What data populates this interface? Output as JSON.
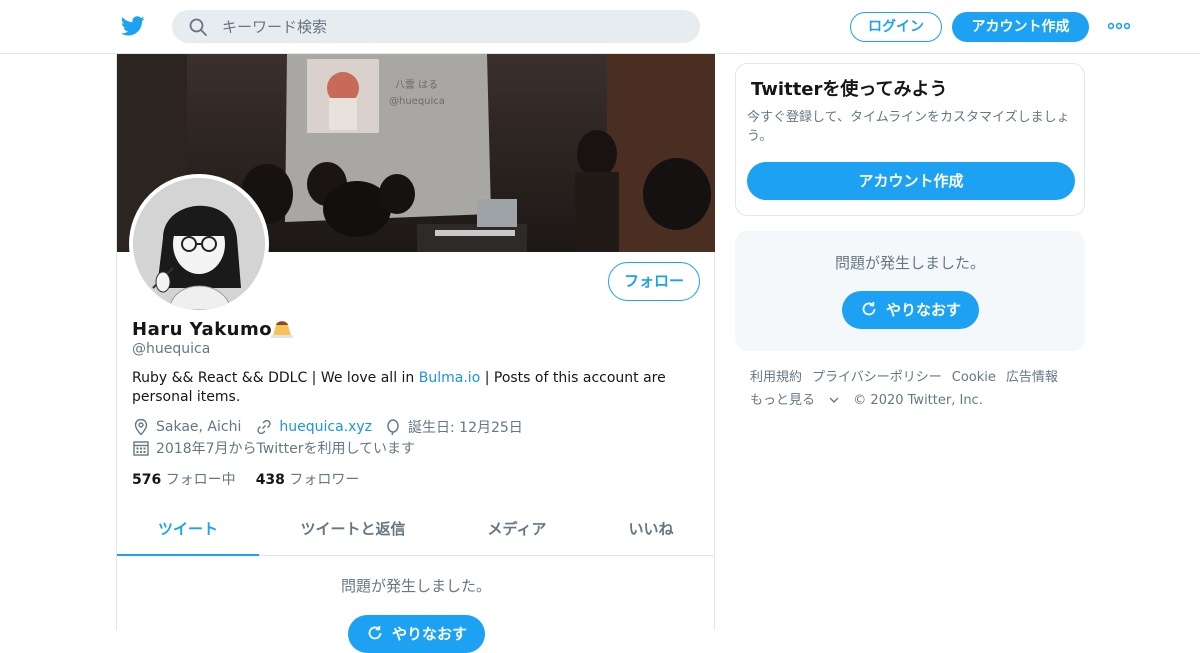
{
  "header": {
    "search_placeholder": "キーワード検索",
    "login_label": "ログイン",
    "signup_label": "アカウント作成",
    "brand_color": "#1da1f2"
  },
  "profile": {
    "display_name": "Haru Yakumo",
    "handle": "@huequica",
    "bio_prefix": "Ruby && React && DDLC | We love all in ",
    "bio_link": "Bulma.io",
    "bio_suffix": " | Posts of this account are personal items.",
    "location": "Sakae, Aichi",
    "website": "huequica.xyz",
    "birthday": "誕生日: 12月25日",
    "joined": "2018年7月からTwitterを利用しています",
    "following_count": "576",
    "following_label": "フォロー中",
    "followers_count": "438",
    "followers_label": "フォロワー",
    "follow_button": "フォロー",
    "banner_slide_name": "八雲 はる",
    "banner_slide_handle": "@huequica"
  },
  "tabs": [
    {
      "label": "ツイート",
      "active": true
    },
    {
      "label": "ツイートと返信",
      "active": false
    },
    {
      "label": "メディア",
      "active": false
    },
    {
      "label": "いいね",
      "active": false
    }
  ],
  "timeline": {
    "error_text": "問題が発生しました。",
    "retry_label": "やりなおす"
  },
  "sidebar": {
    "signup_card": {
      "title": "Twitterを使ってみよう",
      "description": "今すぐ登録して、タイムラインをカスタマイズしましょう。",
      "button": "アカウント作成"
    },
    "error_card": {
      "error_text": "問題が発生しました。",
      "retry_label": "やりなおす"
    },
    "footer": {
      "links": [
        "利用規約",
        "プライバシーポリシー",
        "Cookie",
        "広告情報",
        "もっと見る"
      ],
      "copyright": "© 2020 Twitter, Inc."
    }
  }
}
